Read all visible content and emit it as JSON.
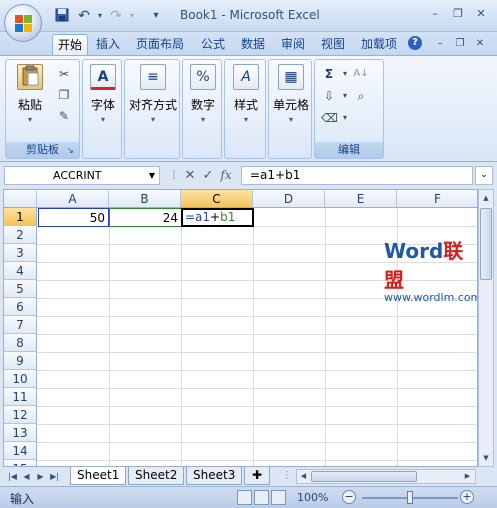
{
  "window": {
    "title": "Book1 - Microsoft Excel",
    "minimize_glyph": "–",
    "restore_glyph": "❐",
    "close_glyph": "✕"
  },
  "quick_access": {
    "save_icon": "save-icon",
    "undo_glyph": "↶",
    "redo_glyph": "↷",
    "customize_glyph": "▾"
  },
  "tabs": [
    {
      "label": "开始",
      "active": true
    },
    {
      "label": "插入",
      "active": false
    },
    {
      "label": "页面布局",
      "active": false
    },
    {
      "label": "公式",
      "active": false
    },
    {
      "label": "数据",
      "active": false
    },
    {
      "label": "审阅",
      "active": false
    },
    {
      "label": "视图",
      "active": false
    },
    {
      "label": "加载项",
      "active": false
    }
  ],
  "ribbon": {
    "clipboard": {
      "group": "剪贴板",
      "paste": "粘贴"
    },
    "font": {
      "label": "字体"
    },
    "alignment": {
      "label": "对齐方式"
    },
    "number": {
      "label": "数字",
      "icon_text": "%"
    },
    "styles": {
      "label": "样式"
    },
    "cells": {
      "label": "单元格"
    },
    "editing": {
      "group": "编辑",
      "sum_glyph": "Σ",
      "find_glyph": "🔍"
    }
  },
  "formula_bar": {
    "name_box": "ACCRINT",
    "cancel_glyph": "✕",
    "enter_glyph": "✓",
    "fx_label": "fx",
    "formula": "=a1+b1"
  },
  "sheet": {
    "columns": [
      "A",
      "B",
      "C",
      "D",
      "E",
      "F"
    ],
    "selected_column": "C",
    "rows": [
      "1",
      "2",
      "3",
      "4",
      "5",
      "6",
      "7",
      "8",
      "9",
      "10",
      "11",
      "12",
      "13",
      "14",
      "15"
    ],
    "selected_row": "1",
    "cells": {
      "A1": "50",
      "B1": "24",
      "C1_part1": "=a1",
      "C1_part2": "+",
      "C1_part3": "b1"
    },
    "colors": {
      "ref_a": "#2c3fb6",
      "ref_b": "#2e8a2e"
    }
  },
  "watermark": {
    "word": "Word",
    "cn": "联盟",
    "url": "www.wordlm.com"
  },
  "sheet_tabs": [
    {
      "label": "Sheet1",
      "active": true
    },
    {
      "label": "Sheet2",
      "active": false
    },
    {
      "label": "Sheet3",
      "active": false
    }
  ],
  "status": {
    "mode": "输入",
    "zoom": "100%"
  }
}
